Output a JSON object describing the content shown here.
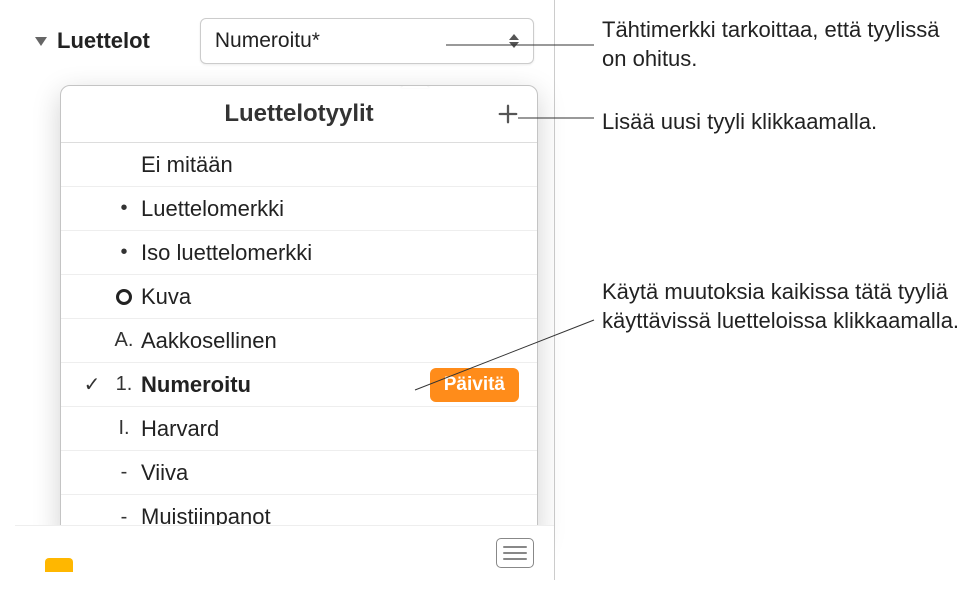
{
  "header": {
    "label": "Luettelot",
    "select_value": "Numeroitu*"
  },
  "popover": {
    "title": "Luettelotyylit",
    "items": [
      {
        "prefix": "",
        "name": "Ei mitään",
        "bold": false,
        "checked": false,
        "prefix_kind": "none"
      },
      {
        "prefix": "•",
        "name": "Luettelomerkki",
        "bold": false,
        "checked": false,
        "prefix_kind": "text"
      },
      {
        "prefix": "•",
        "name": "Iso luettelomerkki",
        "bold": false,
        "checked": false,
        "prefix_kind": "text"
      },
      {
        "prefix": "",
        "name": "Kuva",
        "bold": false,
        "checked": false,
        "prefix_kind": "ring"
      },
      {
        "prefix": "A.",
        "name": "Aakkosellinen",
        "bold": false,
        "checked": false,
        "prefix_kind": "text"
      },
      {
        "prefix": "1.",
        "name": "Numeroitu",
        "bold": true,
        "checked": true,
        "prefix_kind": "text",
        "update": true
      },
      {
        "prefix": "I.",
        "name": "Harvard",
        "bold": false,
        "checked": false,
        "prefix_kind": "text"
      },
      {
        "prefix": "-",
        "name": "Viiva",
        "bold": false,
        "checked": false,
        "prefix_kind": "text"
      },
      {
        "prefix": "-",
        "name": "Muistiinpanot",
        "bold": false,
        "checked": false,
        "prefix_kind": "text"
      }
    ],
    "update_label": "Päivitä"
  },
  "callouts": {
    "asterisk": "Tähtimerkki tarkoittaa, että tyylissä on ohitus.",
    "add": "Lisää uusi tyyli klikkaamalla.",
    "update": "Käytä muutoksia kaikissa tätä tyyliä käyttävissä luetteloissa klikkaamalla."
  }
}
